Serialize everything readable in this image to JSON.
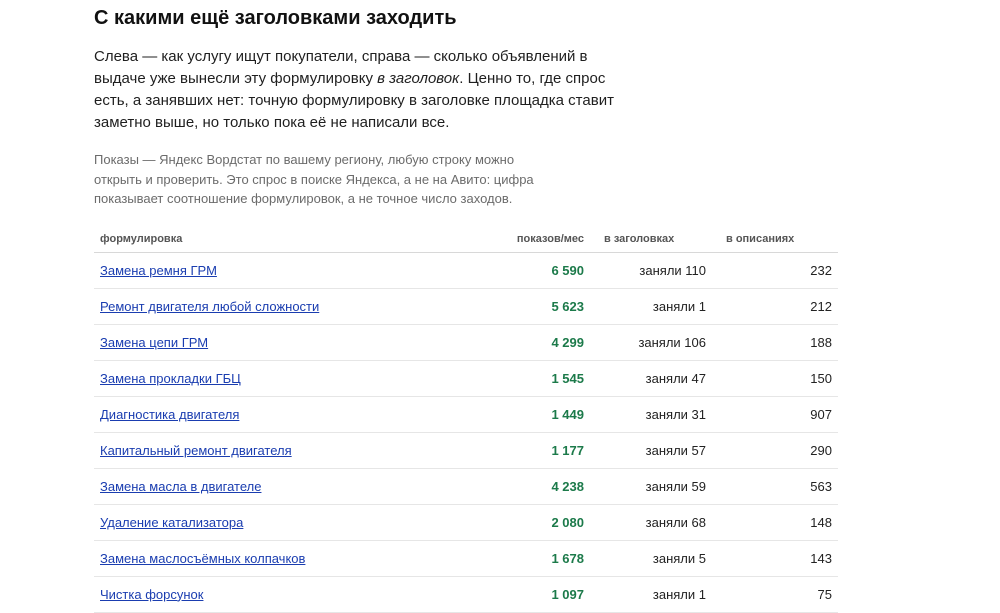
{
  "heading": "С какими ещё заголовками заходить",
  "lead": {
    "part1": "Слева — как услугу ищут покупатели, справа — сколько объявлений в выдаче уже вынесли эту формулировку ",
    "emph": "в заголовок",
    "part2": ". Ценно то, где спрос есть, а занявших нет: точную формулировку в заголовке площадка ставит заметно выше, но только пока её не написали все."
  },
  "note": "Показы — Яндекс Вордстат по вашему региону, любую строку можно открыть и проверить. Это спрос в поиске Яндекса, а не на Авито: цифра показывает соотношение формулировок, а не точное число заходов.",
  "table": {
    "headers": {
      "name": "формулировка",
      "shows": "показов/мес",
      "titles": "в заголовках",
      "desc": "в описаниях"
    },
    "colors": {
      "link": "#1a3db0",
      "shows": "#1c7a4a"
    },
    "rows": [
      {
        "name": "Замена ремня ГРМ",
        "shows": "6 590",
        "titles": "заняли 110",
        "desc": "232"
      },
      {
        "name": "Ремонт двигателя любой сложности",
        "shows": "5 623",
        "titles": "заняли 1",
        "desc": "212"
      },
      {
        "name": "Замена цепи ГРМ",
        "shows": "4 299",
        "titles": "заняли 106",
        "desc": "188"
      },
      {
        "name": "Замена прокладки ГБЦ",
        "shows": "1 545",
        "titles": "заняли 47",
        "desc": "150"
      },
      {
        "name": "Диагностика двигателя",
        "shows": "1 449",
        "titles": "заняли 31",
        "desc": "907"
      },
      {
        "name": "Капитальный ремонт двигателя",
        "shows": "1 177",
        "titles": "заняли 57",
        "desc": "290"
      },
      {
        "name": "Замена масла в двигателе",
        "shows": "4 238",
        "titles": "заняли 59",
        "desc": "563"
      },
      {
        "name": "Удаление катализатора",
        "shows": "2 080",
        "titles": "заняли 68",
        "desc": "148"
      },
      {
        "name": "Замена маслосъёмных колпачков",
        "shows": "1 678",
        "titles": "заняли 5",
        "desc": "143"
      },
      {
        "name": "Чистка форсунок",
        "shows": "1 097",
        "titles": "заняли 1",
        "desc": "75"
      }
    ]
  }
}
